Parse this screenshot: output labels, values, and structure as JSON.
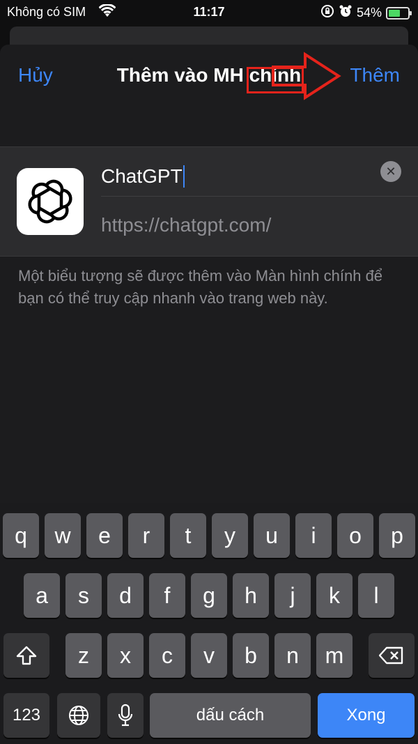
{
  "status": {
    "carrier": "Không có SIM",
    "time": "11:17",
    "battery_percent": "54%",
    "battery_level": 0.54
  },
  "sheet": {
    "cancel_label": "Hủy",
    "title": "Thêm vào MH chính",
    "add_label": "Thêm",
    "name_value": "ChatGPT",
    "url": "https://chatgpt.com/",
    "description": "Một biểu tượng sẽ được thêm vào Màn hình chính để bạn có thể truy cập nhanh vào trang web này."
  },
  "annotation": {
    "color": "#e5231b"
  },
  "keyboard": {
    "row1": [
      "q",
      "w",
      "e",
      "r",
      "t",
      "y",
      "u",
      "i",
      "o",
      "p"
    ],
    "row2": [
      "a",
      "s",
      "d",
      "f",
      "g",
      "h",
      "j",
      "k",
      "l"
    ],
    "row3": [
      "z",
      "x",
      "c",
      "v",
      "b",
      "n",
      "m"
    ],
    "numbers_label": "123",
    "space_label": "dấu cách",
    "done_label": "Xong",
    "icons": [
      "shift-icon",
      "backspace-icon",
      "globe-icon",
      "microphone-icon"
    ]
  },
  "colors": {
    "accent": "#3d86f7",
    "sheet_bg": "#1c1c1e",
    "key_bg": "#5a5a5e"
  }
}
